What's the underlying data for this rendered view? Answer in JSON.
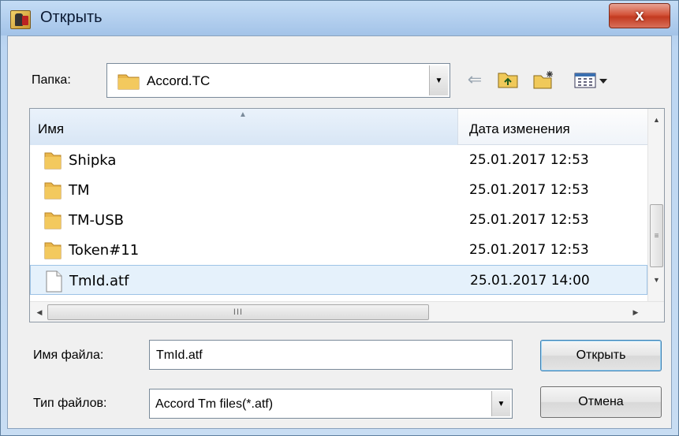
{
  "window": {
    "title": "Открыть",
    "close_label": "x"
  },
  "folder": {
    "label": "Папка:",
    "value": "Accord.TC"
  },
  "toolbar": [
    "back-icon",
    "up-folder-icon",
    "new-folder-icon",
    "view-menu-icon"
  ],
  "columns": {
    "name": "Имя",
    "date": "Дата изменения"
  },
  "files": [
    {
      "name": "Shipka",
      "date": "25.01.2017 12:53",
      "type": "folder",
      "selected": false
    },
    {
      "name": "TM",
      "date": "25.01.2017 12:53",
      "type": "folder",
      "selected": false
    },
    {
      "name": "TM-USB",
      "date": "25.01.2017 12:53",
      "type": "folder",
      "selected": false
    },
    {
      "name": "Token#11",
      "date": "25.01.2017 12:53",
      "type": "folder",
      "selected": false
    },
    {
      "name": "TmId.atf",
      "date": "25.01.2017 14:00",
      "type": "file",
      "selected": true
    }
  ],
  "filename": {
    "label": "Имя файла:",
    "value": "TmId.atf"
  },
  "filetype": {
    "label": "Тип файлов:",
    "value": "Accord Tm files(*.atf)"
  },
  "buttons": {
    "open": "Открыть",
    "cancel": "Отмена"
  },
  "hscroll_thumb_grip": "III",
  "colors": {
    "folder": "#e9b64a",
    "selection": "#e5f1fb",
    "selection_border": "#9dc3e6"
  }
}
